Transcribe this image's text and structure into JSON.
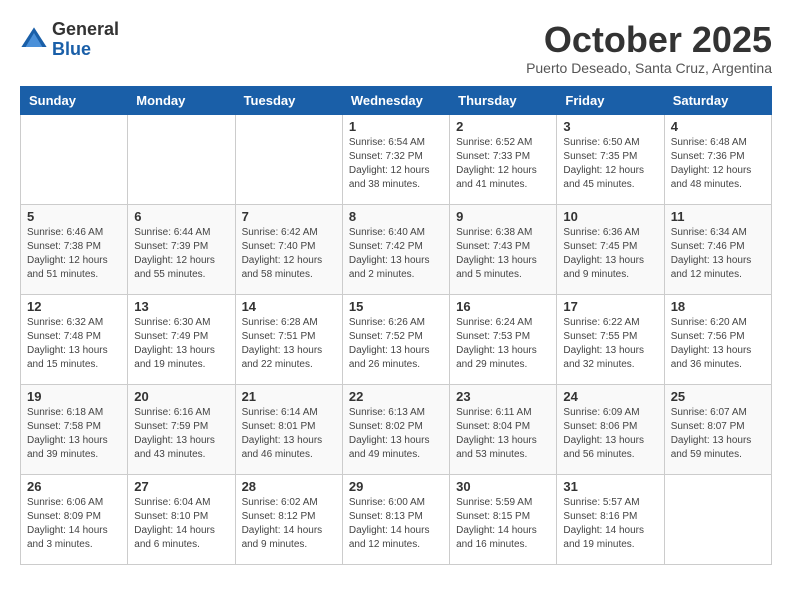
{
  "header": {
    "logo": {
      "general": "General",
      "blue": "Blue"
    },
    "title": "October 2025",
    "subtitle": "Puerto Deseado, Santa Cruz, Argentina"
  },
  "days_of_week": [
    "Sunday",
    "Monday",
    "Tuesday",
    "Wednesday",
    "Thursday",
    "Friday",
    "Saturday"
  ],
  "weeks": [
    [
      {
        "day": "",
        "info": ""
      },
      {
        "day": "",
        "info": ""
      },
      {
        "day": "",
        "info": ""
      },
      {
        "day": "1",
        "info": "Sunrise: 6:54 AM\nSunset: 7:32 PM\nDaylight: 12 hours\nand 38 minutes."
      },
      {
        "day": "2",
        "info": "Sunrise: 6:52 AM\nSunset: 7:33 PM\nDaylight: 12 hours\nand 41 minutes."
      },
      {
        "day": "3",
        "info": "Sunrise: 6:50 AM\nSunset: 7:35 PM\nDaylight: 12 hours\nand 45 minutes."
      },
      {
        "day": "4",
        "info": "Sunrise: 6:48 AM\nSunset: 7:36 PM\nDaylight: 12 hours\nand 48 minutes."
      }
    ],
    [
      {
        "day": "5",
        "info": "Sunrise: 6:46 AM\nSunset: 7:38 PM\nDaylight: 12 hours\nand 51 minutes."
      },
      {
        "day": "6",
        "info": "Sunrise: 6:44 AM\nSunset: 7:39 PM\nDaylight: 12 hours\nand 55 minutes."
      },
      {
        "day": "7",
        "info": "Sunrise: 6:42 AM\nSunset: 7:40 PM\nDaylight: 12 hours\nand 58 minutes."
      },
      {
        "day": "8",
        "info": "Sunrise: 6:40 AM\nSunset: 7:42 PM\nDaylight: 13 hours\nand 2 minutes."
      },
      {
        "day": "9",
        "info": "Sunrise: 6:38 AM\nSunset: 7:43 PM\nDaylight: 13 hours\nand 5 minutes."
      },
      {
        "day": "10",
        "info": "Sunrise: 6:36 AM\nSunset: 7:45 PM\nDaylight: 13 hours\nand 9 minutes."
      },
      {
        "day": "11",
        "info": "Sunrise: 6:34 AM\nSunset: 7:46 PM\nDaylight: 13 hours\nand 12 minutes."
      }
    ],
    [
      {
        "day": "12",
        "info": "Sunrise: 6:32 AM\nSunset: 7:48 PM\nDaylight: 13 hours\nand 15 minutes."
      },
      {
        "day": "13",
        "info": "Sunrise: 6:30 AM\nSunset: 7:49 PM\nDaylight: 13 hours\nand 19 minutes."
      },
      {
        "day": "14",
        "info": "Sunrise: 6:28 AM\nSunset: 7:51 PM\nDaylight: 13 hours\nand 22 minutes."
      },
      {
        "day": "15",
        "info": "Sunrise: 6:26 AM\nSunset: 7:52 PM\nDaylight: 13 hours\nand 26 minutes."
      },
      {
        "day": "16",
        "info": "Sunrise: 6:24 AM\nSunset: 7:53 PM\nDaylight: 13 hours\nand 29 minutes."
      },
      {
        "day": "17",
        "info": "Sunrise: 6:22 AM\nSunset: 7:55 PM\nDaylight: 13 hours\nand 32 minutes."
      },
      {
        "day": "18",
        "info": "Sunrise: 6:20 AM\nSunset: 7:56 PM\nDaylight: 13 hours\nand 36 minutes."
      }
    ],
    [
      {
        "day": "19",
        "info": "Sunrise: 6:18 AM\nSunset: 7:58 PM\nDaylight: 13 hours\nand 39 minutes."
      },
      {
        "day": "20",
        "info": "Sunrise: 6:16 AM\nSunset: 7:59 PM\nDaylight: 13 hours\nand 43 minutes."
      },
      {
        "day": "21",
        "info": "Sunrise: 6:14 AM\nSunset: 8:01 PM\nDaylight: 13 hours\nand 46 minutes."
      },
      {
        "day": "22",
        "info": "Sunrise: 6:13 AM\nSunset: 8:02 PM\nDaylight: 13 hours\nand 49 minutes."
      },
      {
        "day": "23",
        "info": "Sunrise: 6:11 AM\nSunset: 8:04 PM\nDaylight: 13 hours\nand 53 minutes."
      },
      {
        "day": "24",
        "info": "Sunrise: 6:09 AM\nSunset: 8:06 PM\nDaylight: 13 hours\nand 56 minutes."
      },
      {
        "day": "25",
        "info": "Sunrise: 6:07 AM\nSunset: 8:07 PM\nDaylight: 13 hours\nand 59 minutes."
      }
    ],
    [
      {
        "day": "26",
        "info": "Sunrise: 6:06 AM\nSunset: 8:09 PM\nDaylight: 14 hours\nand 3 minutes."
      },
      {
        "day": "27",
        "info": "Sunrise: 6:04 AM\nSunset: 8:10 PM\nDaylight: 14 hours\nand 6 minutes."
      },
      {
        "day": "28",
        "info": "Sunrise: 6:02 AM\nSunset: 8:12 PM\nDaylight: 14 hours\nand 9 minutes."
      },
      {
        "day": "29",
        "info": "Sunrise: 6:00 AM\nSunset: 8:13 PM\nDaylight: 14 hours\nand 12 minutes."
      },
      {
        "day": "30",
        "info": "Sunrise: 5:59 AM\nSunset: 8:15 PM\nDaylight: 14 hours\nand 16 minutes."
      },
      {
        "day": "31",
        "info": "Sunrise: 5:57 AM\nSunset: 8:16 PM\nDaylight: 14 hours\nand 19 minutes."
      },
      {
        "day": "",
        "info": ""
      }
    ]
  ]
}
